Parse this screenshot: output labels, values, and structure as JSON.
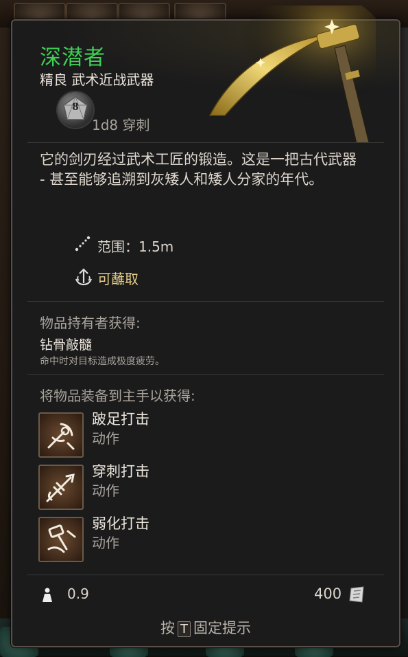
{
  "item": {
    "name": "深潜者",
    "subtitle": "精良 武术近战武器",
    "damage_die": "8",
    "damage": "1d8 穿刺",
    "description": "它的剑刃经过武术工匠的锻造。这是一把古代武器 - 甚至能够追溯到灰矮人和矮人分家的年代。",
    "range": "范围：1.5m",
    "dippable": "可蘸取"
  },
  "passive": {
    "header": "物品持有者获得:",
    "name": "钻骨敲髓",
    "description": "命中时对目标造成极度疲劳。"
  },
  "equip": {
    "header": "将物品装备到主手以获得:",
    "actions": [
      {
        "name": "跛足打击",
        "type": "动作",
        "icon": "lacerating-strike-icon"
      },
      {
        "name": "穿刺打击",
        "type": "动作",
        "icon": "piercing-strike-icon"
      },
      {
        "name": "弱化打击",
        "type": "动作",
        "icon": "weakening-strike-icon"
      }
    ]
  },
  "footer": {
    "weight": "0.9",
    "price": "400"
  },
  "hint": {
    "prefix": "按",
    "key": "T",
    "suffix": "固定提示"
  },
  "colors": {
    "rarity_green": "#3fcf55",
    "dip_gold": "#e9d08a",
    "panel_bg": "#1b1b1c"
  }
}
